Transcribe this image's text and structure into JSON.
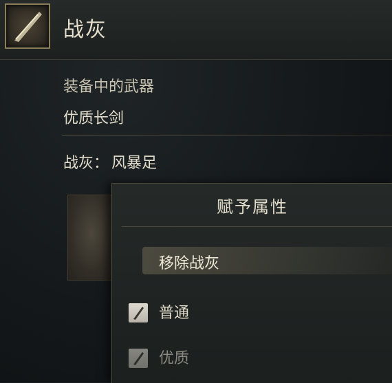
{
  "header": {
    "title": "战灰",
    "icon": "ash-of-war-icon"
  },
  "equipped": {
    "label": "装备中的武器",
    "weapon": "优质长剑"
  },
  "ash": {
    "label": "战灰：",
    "value": "风暴足"
  },
  "submenu": {
    "title": "赋予属性",
    "options": [
      {
        "label": "移除战灰",
        "selected": true
      },
      {
        "label": "普通",
        "icon": "affinity-icon",
        "available": true
      },
      {
        "label": "优质",
        "icon": "affinity-icon",
        "available": false
      }
    ]
  }
}
